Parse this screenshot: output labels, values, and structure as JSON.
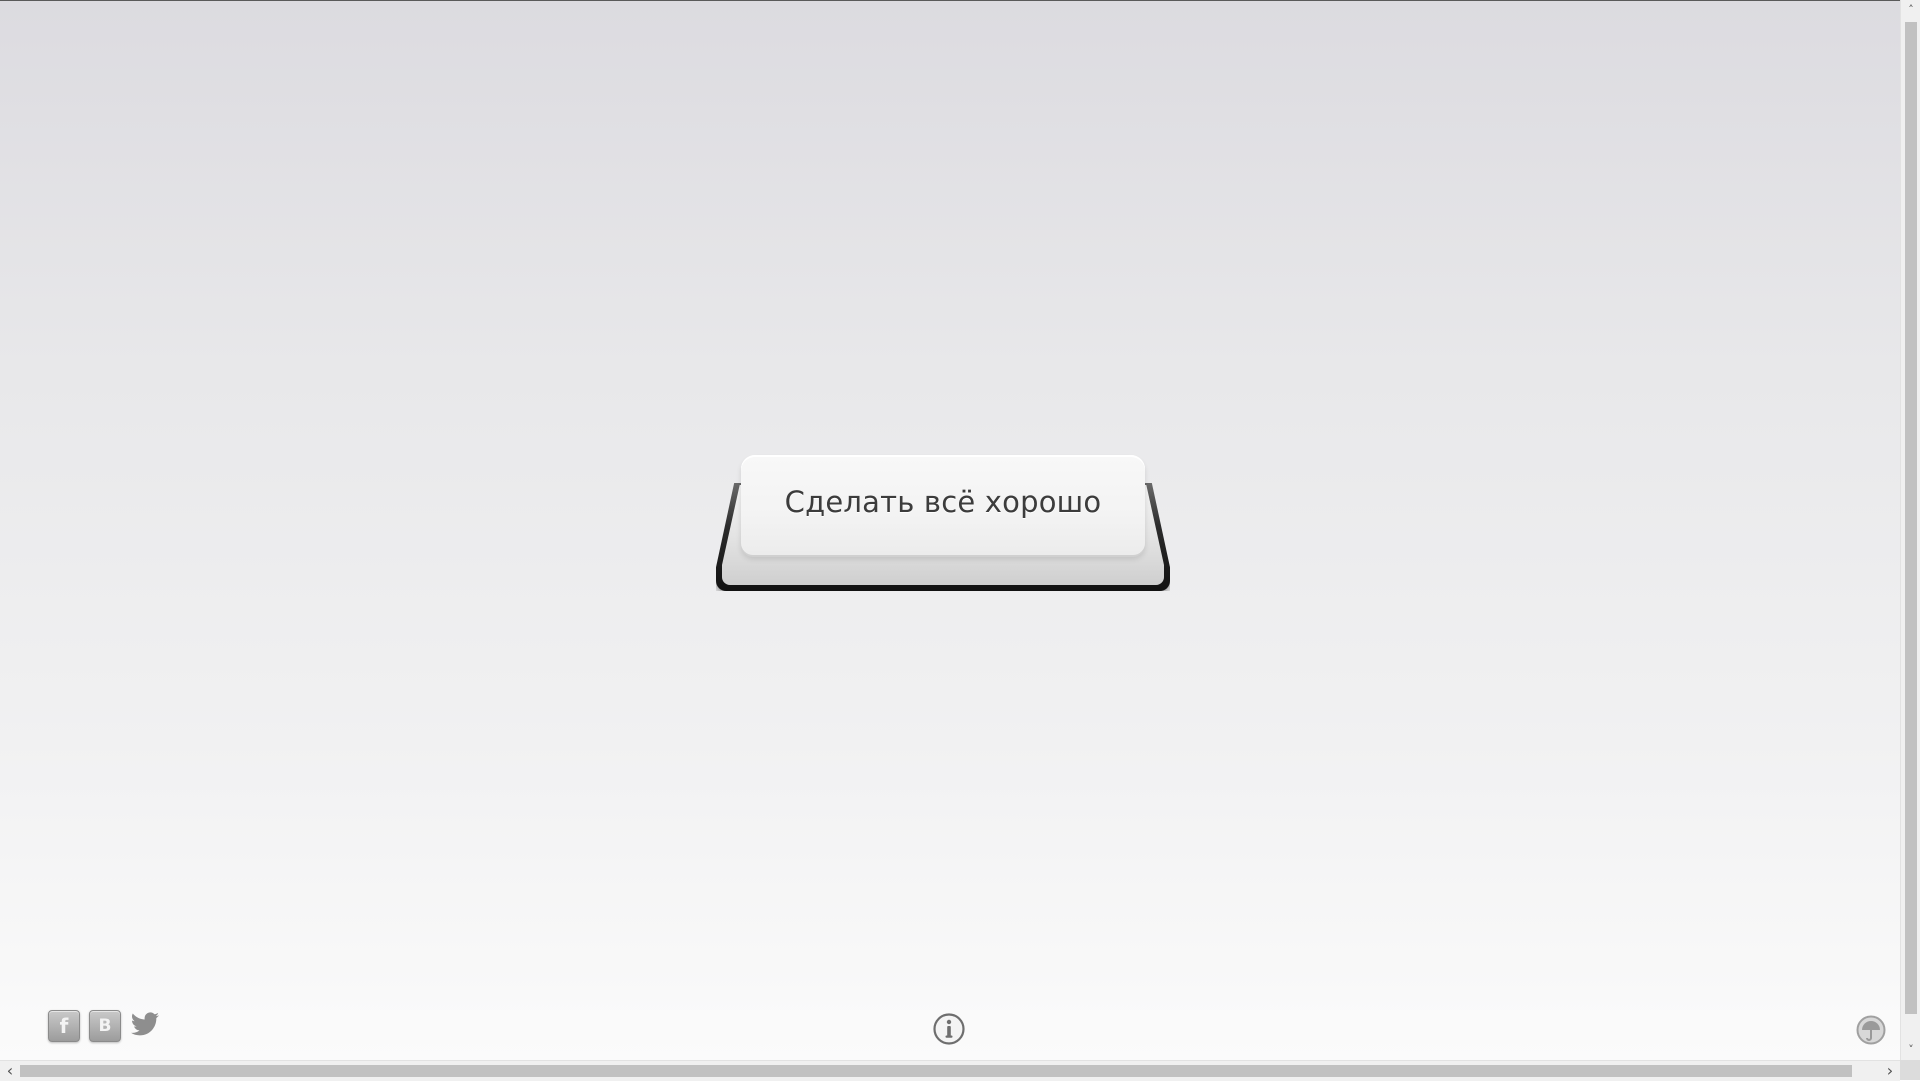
{
  "main_button": {
    "label": "Сделать всё хорошо"
  },
  "footer": {
    "social": [
      {
        "name": "facebook",
        "icon": "facebook-icon",
        "glyph": "f"
      },
      {
        "name": "vkontakte",
        "icon": "vk-icon",
        "glyph": "B"
      },
      {
        "name": "twitter",
        "icon": "twitter-bird-icon"
      }
    ],
    "info_icon": "info-icon",
    "corner_icon": "umbrella-circle-icon"
  },
  "scrollbars": {
    "vertical": {
      "up": "˄",
      "down": "˅"
    },
    "horizontal": {
      "left": "‹",
      "right": "›"
    }
  },
  "colors": {
    "background_top": "#dcdbe0",
    "background_bottom": "#fbfbfb",
    "button_text": "#3c3c3c",
    "icon_gray": "#9c9c9c"
  }
}
